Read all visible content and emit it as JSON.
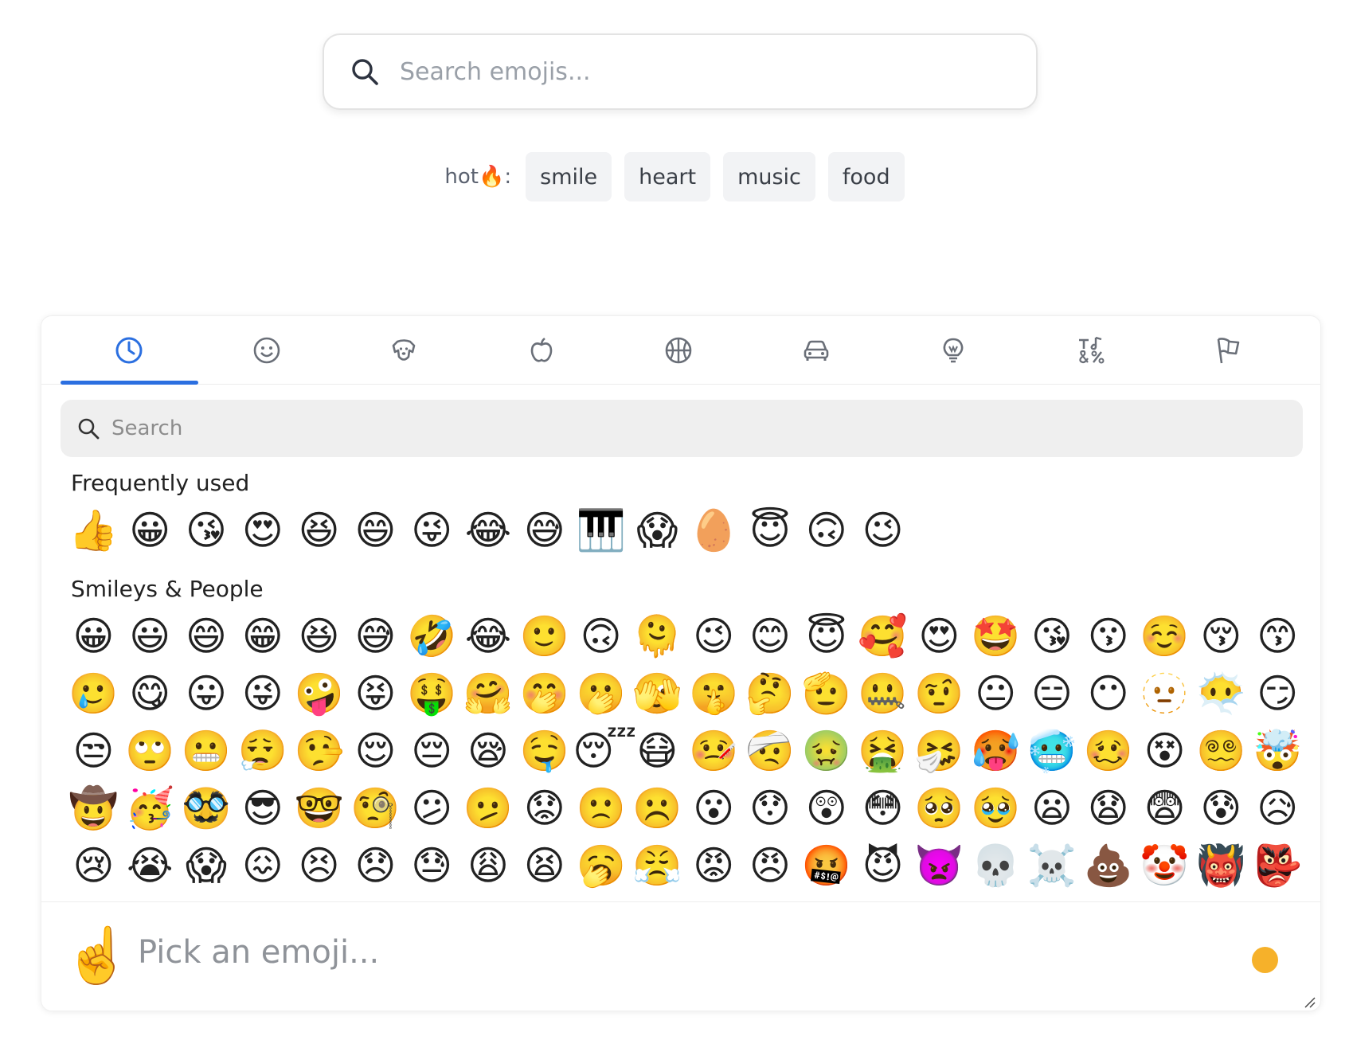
{
  "top_search": {
    "placeholder": "Search emojis..."
  },
  "hot": {
    "label": "hot🔥:",
    "chips": [
      "smile",
      "heart",
      "music",
      "food"
    ]
  },
  "tabs": [
    {
      "icon": "clock-icon",
      "active": true
    },
    {
      "icon": "smiley-icon",
      "active": false
    },
    {
      "icon": "dog-icon",
      "active": false
    },
    {
      "icon": "apple-icon",
      "active": false
    },
    {
      "icon": "basketball-icon",
      "active": false
    },
    {
      "icon": "car-icon",
      "active": false
    },
    {
      "icon": "lightbulb-icon",
      "active": false
    },
    {
      "icon": "symbols-icon",
      "active": false
    },
    {
      "icon": "flag-icon",
      "active": false
    }
  ],
  "inner_search": {
    "placeholder": "Search"
  },
  "sections": {
    "frequent": {
      "title": "Frequently used",
      "emojis": [
        "👍",
        "😀",
        "😘",
        "😍",
        "😆",
        "😄",
        "😜",
        "😂",
        "😅",
        "🎹",
        "😱",
        "🥚",
        "😇",
        "🙃",
        "😉"
      ]
    },
    "smileys": {
      "title": "Smileys & People",
      "emojis": [
        "😀",
        "😃",
        "😄",
        "😁",
        "😆",
        "😅",
        "🤣",
        "😂",
        "🙂",
        "🙃",
        "🫠",
        "😉",
        "😊",
        "😇",
        "🥰",
        "😍",
        "🤩",
        "😘",
        "😗",
        "☺️",
        "😚",
        "😙",
        "🥲",
        "😋",
        "😛",
        "😜",
        "🤪",
        "😝",
        "🤑",
        "🤗",
        "🤭",
        "🫢",
        "🫣",
        "🤫",
        "🤔",
        "🫡",
        "🤐",
        "🤨",
        "😐",
        "😑",
        "😶",
        "🫥",
        "😶‍🌫️",
        "😏",
        "😒",
        "🙄",
        "😬",
        "😮‍💨",
        "🤥",
        "😌",
        "😔",
        "😪",
        "🤤",
        "😴",
        "😷",
        "🤒",
        "🤕",
        "🤢",
        "🤮",
        "🤧",
        "🥵",
        "🥶",
        "🥴",
        "😵",
        "😵‍💫",
        "🤯",
        "🤠",
        "🥳",
        "🥸",
        "😎",
        "🤓",
        "🧐",
        "😕",
        "🫤",
        "😟",
        "🙁",
        "☹️",
        "😮",
        "😯",
        "😲",
        "😳",
        "🥺",
        "🥹",
        "😦",
        "😧",
        "😨",
        "😰",
        "😥",
        "😢",
        "😭",
        "😱",
        "😖",
        "😣",
        "😞",
        "😓",
        "😩",
        "😫",
        "🥱",
        "😤",
        "😡",
        "😠",
        "🤬",
        "😈",
        "👿",
        "💀",
        "☠️",
        "💩",
        "🤡",
        "👹",
        "👺"
      ]
    }
  },
  "footer": {
    "hand": "☝️",
    "preview": "Pick an emoji...",
    "skin_tone_color": "#f6b12a"
  },
  "colors": {
    "accent": "#2b6fe0"
  }
}
